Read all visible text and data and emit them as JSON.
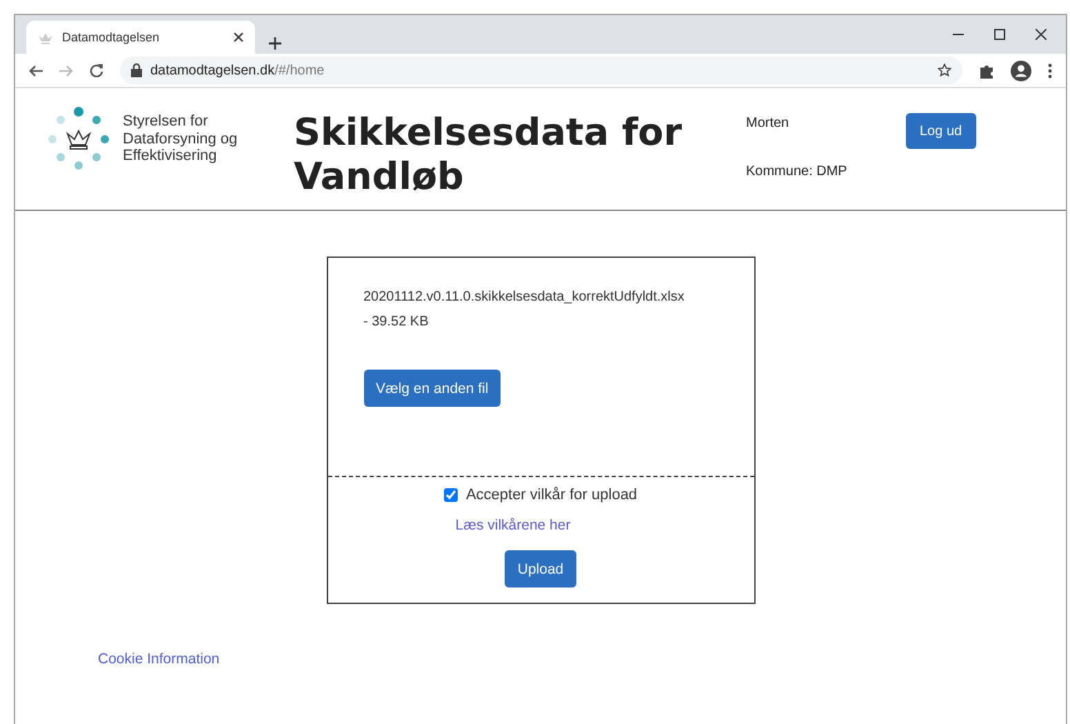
{
  "browser": {
    "tab_title": "Datamodtagelsen",
    "url_domain": "datamodtagelsen.dk",
    "url_path": "/#/home"
  },
  "header": {
    "logo_text": "Styrelsen for Dataforsyning og Effektivisering",
    "title": "Skikkelsesdata for Vandløb",
    "user": "Morten",
    "municipality": "Kommune: DMP",
    "logout": "Log ud"
  },
  "upload": {
    "file_name": "20201112.v0.11.0.skikkelsesdata_korrektUdfyldt.xlsx",
    "file_size": "- 39.52 KB",
    "choose_button": "Vælg en anden fil",
    "accept": {
      "label": "Accepter vilkår for upload",
      "checked": true
    },
    "terms_link": "Læs vilkårene her",
    "upload_button": "Upload"
  },
  "footer": {
    "link": "Cookie Information"
  }
}
